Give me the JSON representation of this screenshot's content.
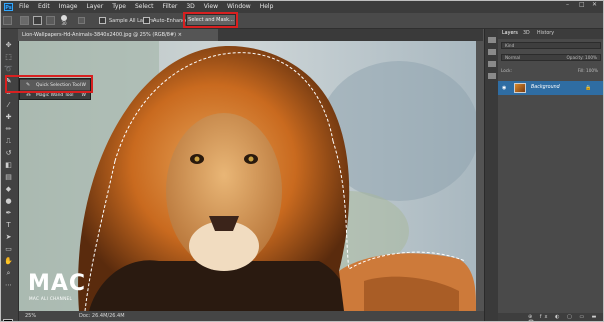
{
  "menu": {
    "logo": "Ps",
    "items": [
      "File",
      "Edit",
      "Image",
      "Layer",
      "Type",
      "Select",
      "Filter",
      "3D",
      "View",
      "Window",
      "Help"
    ],
    "window_controls": [
      "–",
      "□",
      "✕"
    ]
  },
  "options_bar": {
    "brush_size": "30",
    "sample_all_layers": "Sample All Layers",
    "auto_enhance": "Auto-Enhance",
    "select_and_mask": "Select and Mask...",
    "highlight_color": "#d82020"
  },
  "document": {
    "tab_title": "Lion-Wallpapers-Hd-Animals-3840x2400.jpg @ 25% (RGB/8#) ×"
  },
  "tool_flyout": {
    "items": [
      {
        "label": "Quick Selection Tool",
        "shortcut": "W",
        "icon": "quick-selection-icon"
      },
      {
        "label": "Magic Wand Tool",
        "shortcut": "W",
        "icon": "magic-wand-icon"
      }
    ]
  },
  "watermark": {
    "logo": "MAC",
    "subtitle": "MAC ALI CHANNEL"
  },
  "status": {
    "zoom": "25%",
    "doc_size": "Doc: 26.4M/26.4M"
  },
  "layers_panel": {
    "tabs": [
      "Layers",
      "3D",
      "History"
    ],
    "kind_label": "Kind",
    "blend_mode": "Normal",
    "opacity_label": "Opacity: 100%",
    "lock_label": "Lock:",
    "fill_label": "Fill: 100%",
    "layer_name": "Background",
    "footer_icons": "⊕ fx ◐ ▢ ▭ ▬ 🗑",
    "accent": "#2f6da3"
  }
}
